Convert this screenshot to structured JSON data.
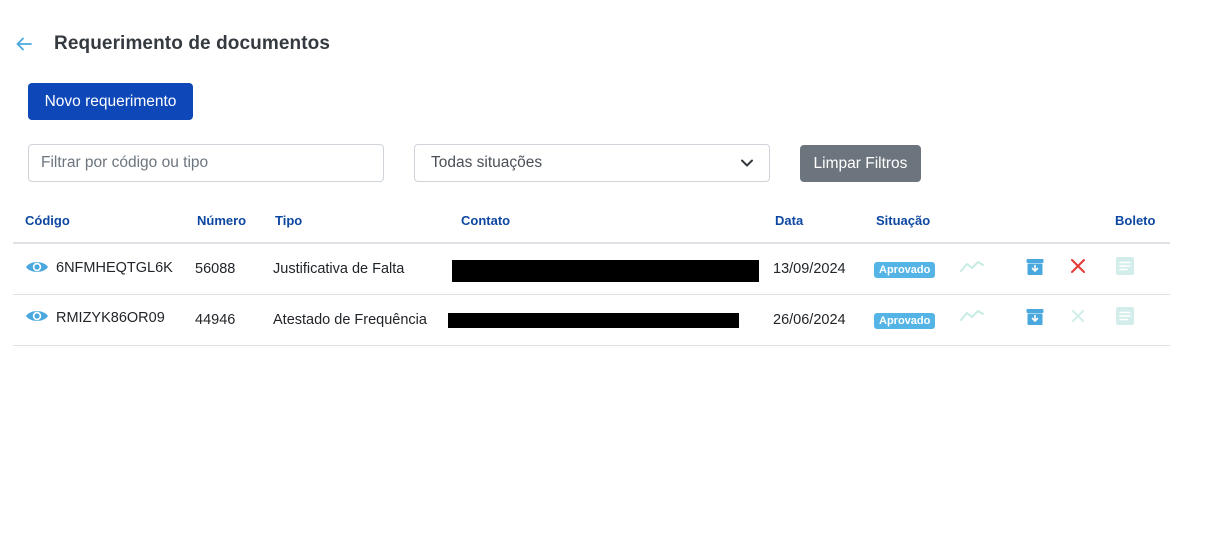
{
  "header": {
    "back_icon": "arrow-left-icon",
    "title": "Requerimento de documentos"
  },
  "toolbar": {
    "new_request_label": "Novo requerimento",
    "filter_placeholder": "Filtrar por código ou tipo",
    "status_select_value": "Todas situações",
    "clear_filters_label": "Limpar Filtros"
  },
  "table": {
    "columns": {
      "codigo": "Código",
      "numero": "Número",
      "tipo": "Tipo",
      "contato": "Contato",
      "data": "Data",
      "situacao": "Situação",
      "boleto": "Boleto"
    },
    "rows": [
      {
        "codigo": "6NFMHEQTGL6K",
        "numero": "56088",
        "tipo": "Justificativa de Falta",
        "contato_redacted": true,
        "data": "13/09/2024",
        "situacao": "Aprovado",
        "cancel_enabled": true
      },
      {
        "codigo": "RMIZYK86OR09",
        "numero": "44946",
        "tipo": "Atestado de Frequência",
        "contato_redacted": true,
        "data": "26/06/2024",
        "situacao": "Aprovado",
        "cancel_enabled": false
      }
    ]
  },
  "colors": {
    "primary": "#0d47b8",
    "header_text": "#0d47a1",
    "badge": "#54b4e6",
    "secondary": "#6c757d",
    "cancel_active": "#e53935",
    "cancel_disabled": "#d3eeea",
    "disabled_icon": "#c7ece4",
    "archive_icon": "#4aa8df"
  },
  "icons": [
    "arrow-left-icon",
    "eye-icon",
    "trend-icon",
    "archive-download-icon",
    "close-icon",
    "document-icon",
    "chevron-down-icon"
  ]
}
